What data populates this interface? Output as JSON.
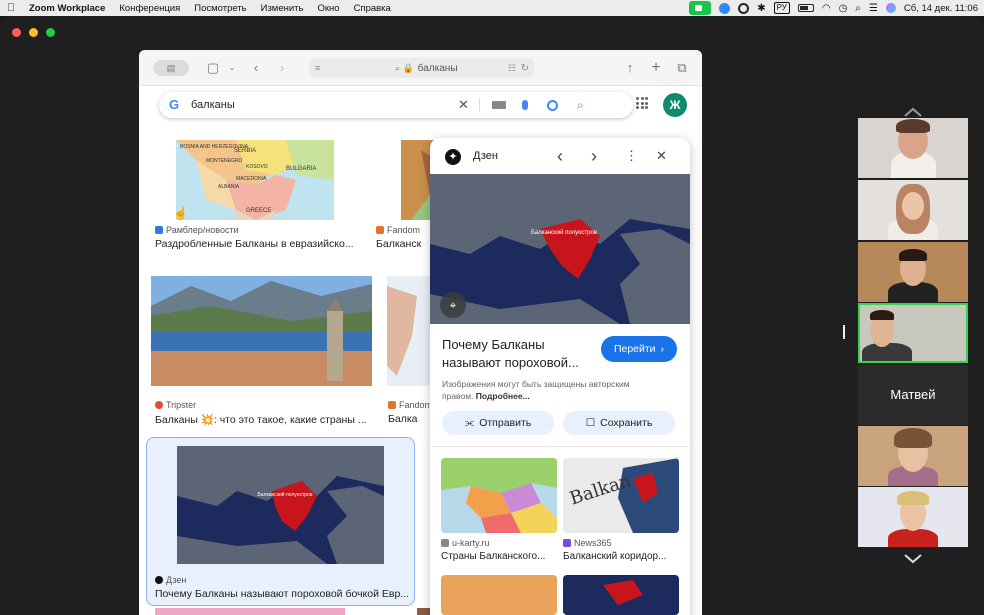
{
  "menubar": {
    "app": "Zoom Workplace",
    "items": [
      "Конференция",
      "Посмотреть",
      "Изменить",
      "Окно",
      "Справка"
    ],
    "keyboard_layout": "РУ",
    "datetime": "Сб, 14 дек.  11:06"
  },
  "safari": {
    "address": "балканы",
    "search_query": "балканы",
    "profile_initial": "Ж"
  },
  "results": [
    {
      "source": "Рамблер/новости",
      "caption": "Раздробленные Балканы в евразийско..."
    },
    {
      "source": "Fandom",
      "caption": "Балканск"
    },
    {
      "source": "Tripster",
      "caption": "Балканы 💥: что это такое, какие страны ..."
    },
    {
      "source": "Fandom",
      "caption": "Балка"
    },
    {
      "source": "Дзен",
      "caption": "Почему Балканы называют пороховой бочкой Евр..."
    }
  ],
  "map_labels": {
    "balkan_peninsula": "Балканский полуостров",
    "countries": [
      "BOSNIA AND HERZEGOVINA",
      "SERBIA",
      "MONTENEGRO",
      "BULGARIA",
      "KOSOVO",
      "MACEDONIA",
      "ALBANIA",
      "GREECE"
    ]
  },
  "panel": {
    "source": "Дзен",
    "title": "Почему Балканы называют пороховой...",
    "go_button": "Перейти",
    "notice": "Изображения могут быть защищены авторским правом.",
    "more": "Подробнее...",
    "send_button": "Отправить",
    "save_button": "Сохранить",
    "related": [
      {
        "source": "u-karty.ru",
        "caption": "Страны Балканского..."
      },
      {
        "source": "News365",
        "caption": "Балканский коридор..."
      }
    ],
    "balkan_word": "Balkan"
  },
  "participants": {
    "named_tile": "Матвей"
  },
  "colors": {
    "google_green_avatar": "#0f8a6e",
    "go_button_blue": "#1a73e8",
    "active_speaker": "#39d353",
    "zoom_bg": "#1f1f1f"
  },
  "icons": [
    "apple-icon",
    "zoom-camera-icon",
    "bluetooth-icon",
    "wifi-icon",
    "battery-icon",
    "search-icon",
    "mic-icon",
    "lens-icon",
    "keyboard-icon",
    "close-icon",
    "apps-grid-icon",
    "share-icon",
    "plus-icon",
    "tabs-icon",
    "back-icon",
    "forward-icon",
    "more-icon",
    "bookmark-icon",
    "chevron-up-icon",
    "chevron-down-icon"
  ]
}
